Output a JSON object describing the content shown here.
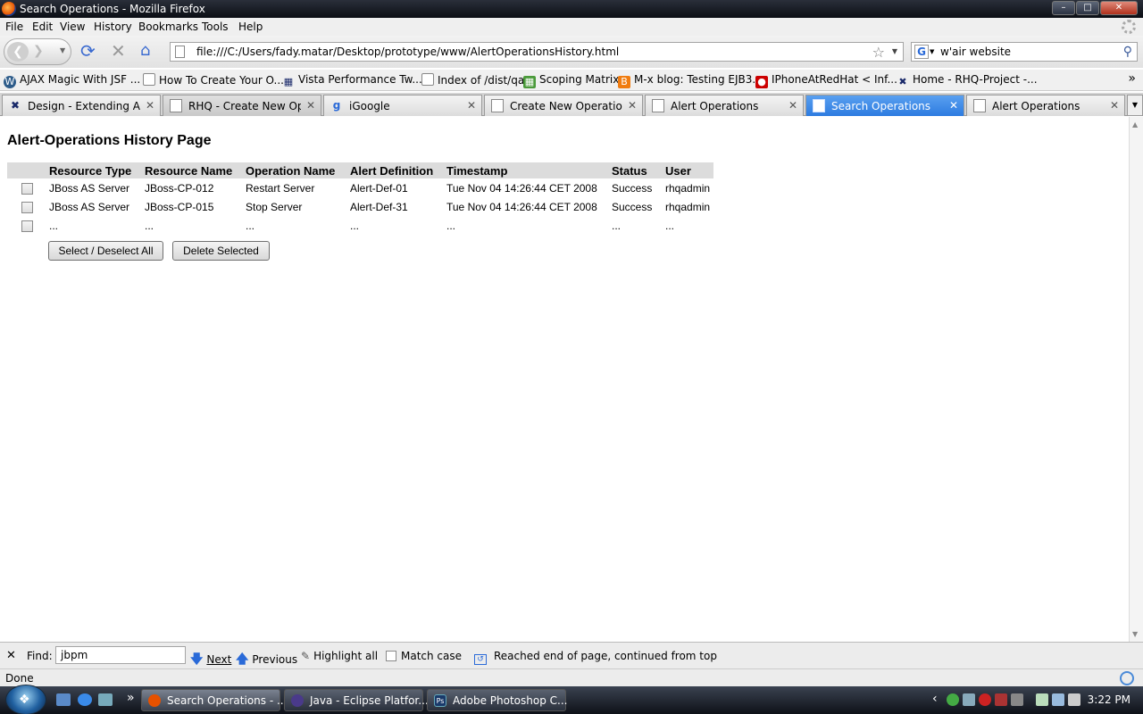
{
  "window": {
    "title": "Search Operations - Mozilla Firefox"
  },
  "menu": [
    "File",
    "Edit",
    "View",
    "History",
    "Bookmarks",
    "Tools",
    "Help"
  ],
  "nav": {
    "url": "file:///C:/Users/fady.matar/Desktop/prototype/www/AlertOperationsHistory.html",
    "search_value": "w'air website"
  },
  "bookmarks": [
    "AJAX Magic With JSF ...",
    "How To Create Your O...",
    "Vista Performance Tw...",
    "Index of /dist/qa",
    "Scoping Matrix",
    "M-x blog: Testing EJB3...",
    "IPhoneAtRedHat < Inf...",
    "Home - RHQ-Project -..."
  ],
  "tabs": [
    "Design - Extending Al...",
    "RHQ - Create New Op...",
    "iGoogle",
    "Create New Operation...",
    "Alert Operations",
    "Search Operations",
    "Alert Operations"
  ],
  "page": {
    "heading": "Alert-Operations History Page",
    "columns": [
      "Resource Type",
      "Resource Name",
      "Operation Name",
      "Alert Definition",
      "Timestamp",
      "Status",
      "User"
    ],
    "rows": [
      [
        "JBoss AS Server",
        "JBoss-CP-012",
        "Restart Server",
        "Alert-Def-01",
        "Tue Nov 04 14:26:44 CET 2008",
        "Success",
        "rhqadmin"
      ],
      [
        "JBoss AS Server",
        "JBoss-CP-015",
        "Stop Server",
        "Alert-Def-31",
        "Tue Nov 04 14:26:44 CET 2008",
        "Success",
        "rhqadmin"
      ],
      [
        "...",
        "...",
        "...",
        "...",
        "...",
        "...",
        "..."
      ]
    ],
    "select_all_label": "Select / Deselect All",
    "delete_label": "Delete Selected"
  },
  "findbar": {
    "label": "Find:",
    "value": "jbpm",
    "next": "Next",
    "previous": "Previous",
    "highlight": "Highlight all",
    "match_case": "Match case",
    "message": "Reached end of page, continued from top"
  },
  "status": "Done",
  "taskbar": {
    "tasks": [
      "Search Operations - ...",
      "Java - Eclipse Platfor...",
      "Adobe Photoshop C..."
    ],
    "clock": "3:22 PM"
  },
  "colors": {
    "active_tab": "#2c7be0",
    "table_header": "#dcdcdc"
  }
}
